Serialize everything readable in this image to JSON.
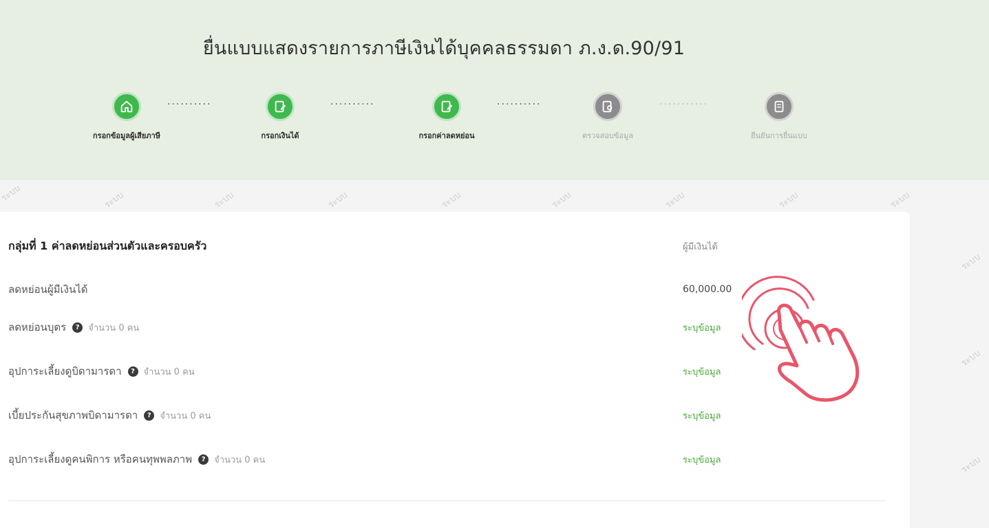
{
  "header": {
    "title": "ยื่นแบบแสดงรายการภาษีเงินได้บุคคลธรรมดา ภ.ง.ด.90/91"
  },
  "steps": [
    {
      "label": "กรอกข้อมูลผู้เสียภาษี",
      "status": "done",
      "icon": "home-icon"
    },
    {
      "label": "กรอกเงินได้",
      "status": "done",
      "icon": "edit-document-icon"
    },
    {
      "label": "กรอกค่าลดหย่อน",
      "status": "done",
      "icon": "edit-document-icon"
    },
    {
      "label": "ตรวจสอบข้อมูล",
      "status": "pending",
      "icon": "review-icon"
    },
    {
      "label": "ยืนยันการยื่นแบบ",
      "status": "pending",
      "icon": "confirm-document-icon"
    }
  ],
  "watermark": "ระบบ",
  "group1": {
    "title": "กลุ่มที่ 1 ค่าลดหย่อนส่วนตัวและครอบครัว",
    "column_header": "ผู้มีเงินได้",
    "rows": [
      {
        "label": "ลดหย่อนผู้มีเงินได้",
        "value": "60,000.00"
      },
      {
        "label": "ลดหย่อนบุตร",
        "count": "จำนวน 0 คน",
        "action": "ระบุข้อมูล"
      },
      {
        "label": "อุปการะเลี้ยงดูบิดามารดา",
        "count": "จำนวน 0 คน",
        "action": "ระบุข้อมูล"
      },
      {
        "label": "เบี้ยประกันสุขภาพบิดามารดา",
        "count": "จำนวน 0 คน",
        "action": "ระบุข้อมูล"
      },
      {
        "label": "อุปการะเลี้ยงดูคนพิการ หรือคนทุพพลภาพ",
        "count": "จำนวน 0 คน",
        "action": "ระบุข้อมูล"
      }
    ]
  },
  "colors": {
    "header_bg": "#e6efe2",
    "step_done": "#3fb94d",
    "step_pending": "#8c8c8c",
    "link_green": "#4caa3a",
    "hand_pointer": "#e8566a"
  }
}
